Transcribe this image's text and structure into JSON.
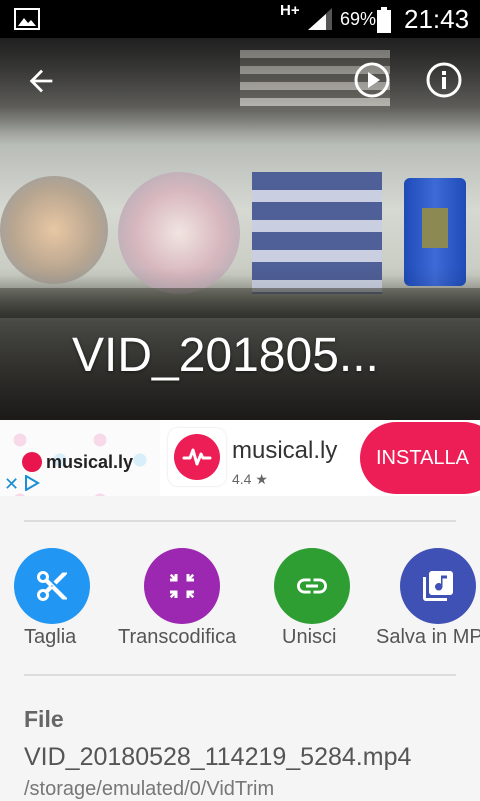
{
  "status_bar": {
    "network": "H+",
    "battery_percent": "69%",
    "time": "21:43",
    "icons": [
      "image-icon",
      "signal-icon",
      "battery-icon"
    ]
  },
  "hero": {
    "video_title": "VID_201805...",
    "icons": [
      "back-arrow-icon",
      "play-circle-icon",
      "info-icon"
    ]
  },
  "ad": {
    "brand_label": "musical.ly",
    "app_name": "musical.ly",
    "rating": "4.4",
    "install_label": "INSTALLA",
    "colors": {
      "brand": "#ed1d55",
      "adchoices": "#1b8fd6"
    }
  },
  "actions": [
    {
      "label": "Taglia",
      "icon": "scissors-icon",
      "color": "#2196f3"
    },
    {
      "label": "Transcodifica",
      "icon": "compress-icon",
      "color": "#9c27b0"
    },
    {
      "label": "Unisci",
      "icon": "link-icon",
      "color": "#2e9e33"
    },
    {
      "label": "Salva in MP",
      "icon": "music-library-icon",
      "color": "#3f51b5"
    }
  ],
  "file": {
    "section_title": "File",
    "name": "VID_20180528_114219_5284.mp4",
    "path": "/storage/emulated/0/VidTrim"
  }
}
